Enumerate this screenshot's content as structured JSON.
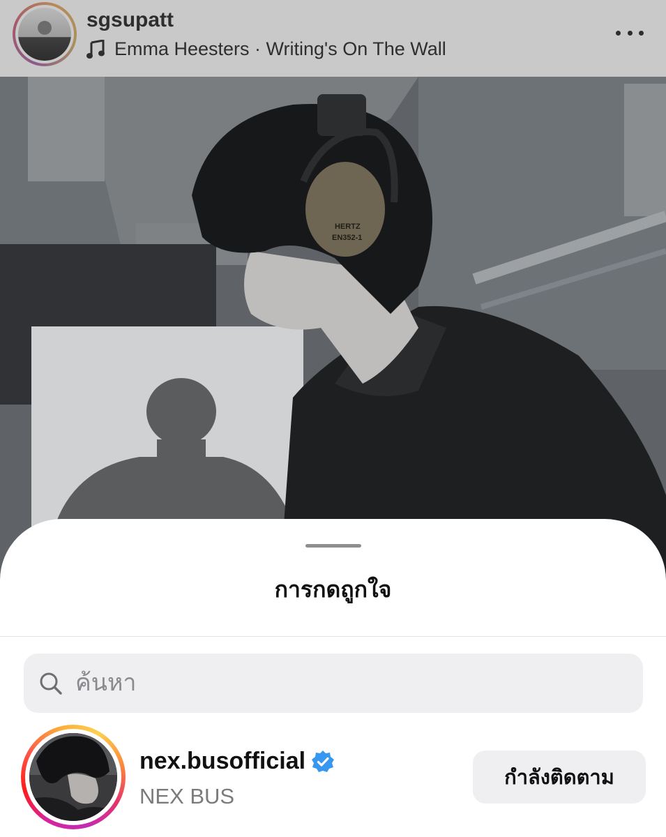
{
  "post": {
    "username": "sgsupatt",
    "music": "Emma Heesters · Writing's On The Wall",
    "photo_earmuff_text": "EN352-1",
    "photo_earmuff_brand": "HERTZ"
  },
  "likes_sheet": {
    "title": "การกดถูกใจ",
    "search_placeholder": "ค้นหา",
    "users": [
      {
        "username": "nex.busofficial",
        "full_name": "NEX BUS",
        "verified": true,
        "follow_label": "กำลังติดตาม"
      }
    ]
  },
  "colors": {
    "dim_overlay": "#c9c9c9",
    "verified_blue": "#3897f0",
    "button_bg": "#efeff1",
    "secondary_text": "#7b7b7b"
  }
}
